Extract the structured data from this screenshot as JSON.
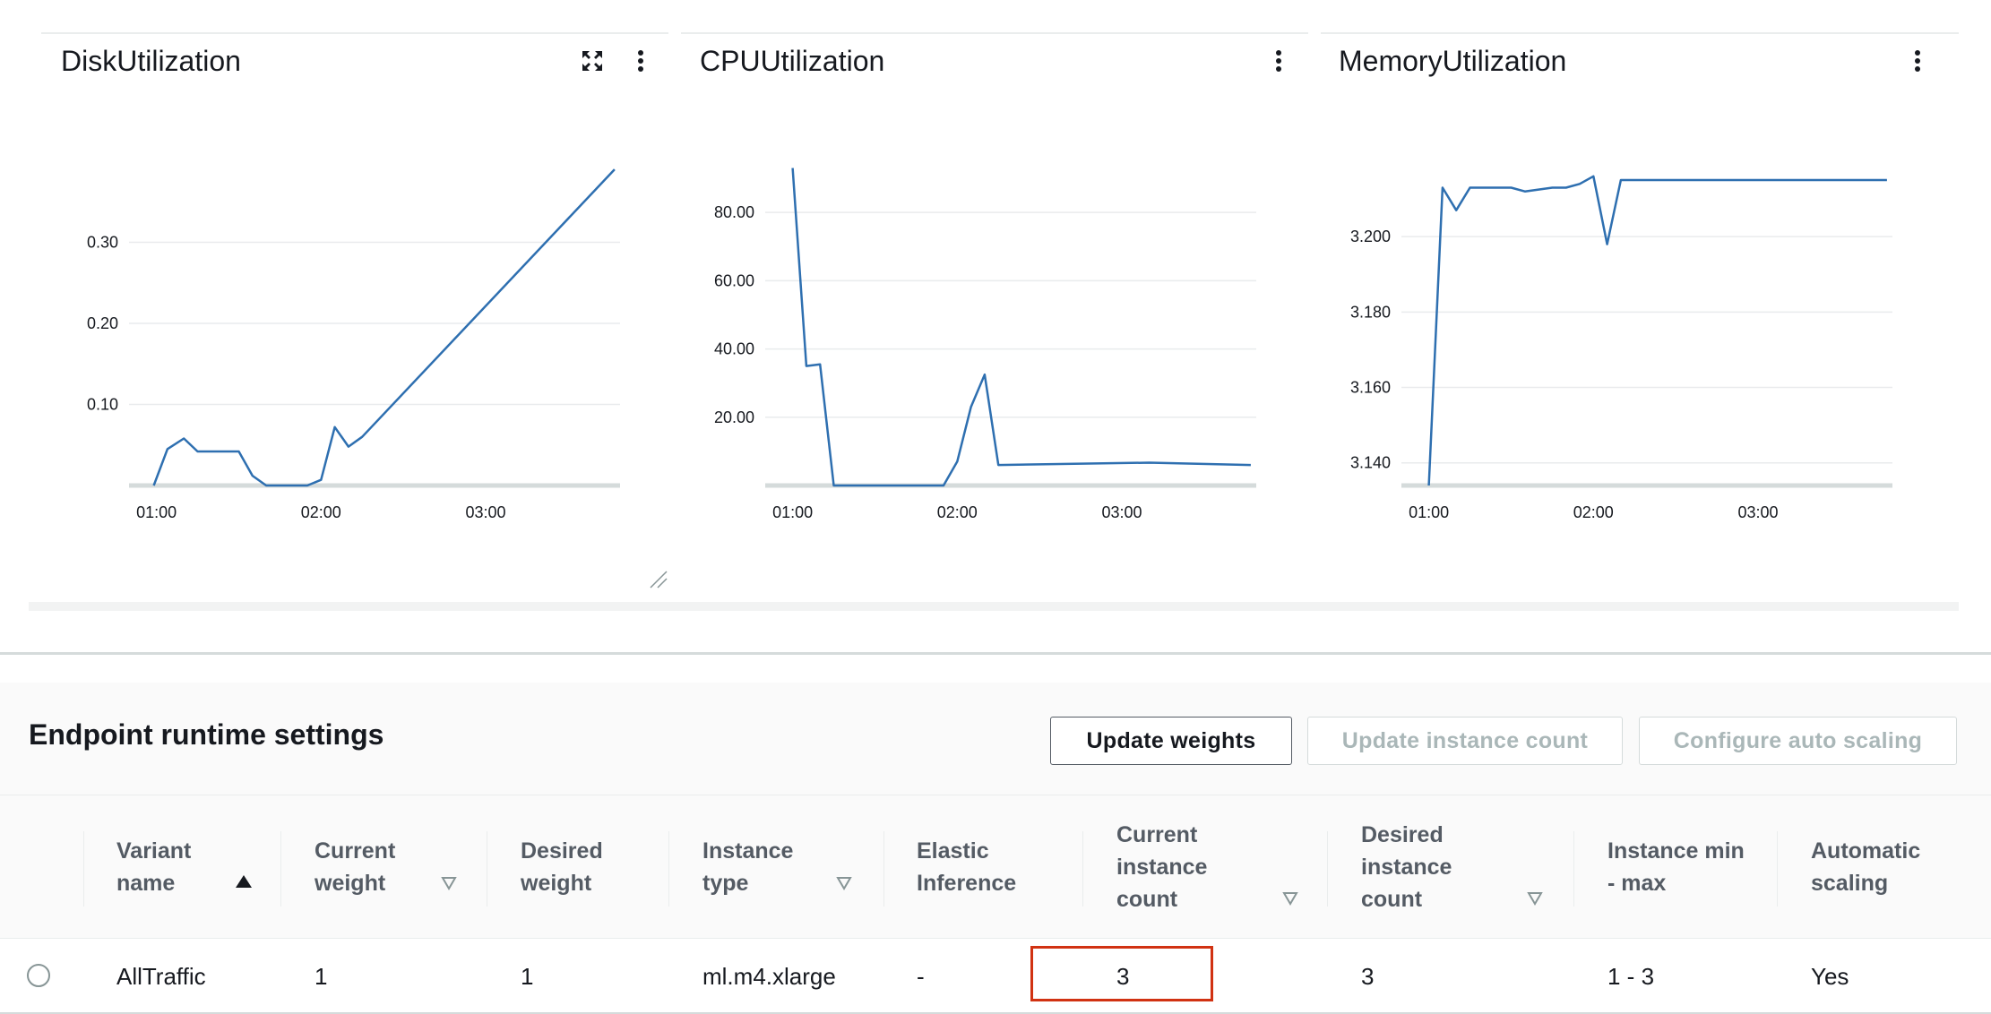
{
  "metrics": {
    "widgets": [
      {
        "title": "DiskUtilization",
        "has_expand": true
      },
      {
        "title": "CPUUtilization",
        "has_expand": false
      },
      {
        "title": "MemoryUtilization",
        "has_expand": false
      }
    ]
  },
  "chart_data": [
    {
      "type": "line",
      "title": "DiskUtilization",
      "x": [
        "00:59",
        "01:04",
        "01:10",
        "01:15",
        "01:20",
        "01:25",
        "01:30",
        "01:35",
        "01:40",
        "01:45",
        "01:50",
        "01:55",
        "02:00",
        "02:05",
        "02:10",
        "02:15",
        "03:47"
      ],
      "y": [
        0.0,
        0.045,
        0.058,
        0.042,
        0.042,
        0.042,
        0.042,
        0.012,
        0.0,
        0.0,
        0.0,
        0.0,
        0.007,
        0.072,
        0.048,
        0.06,
        0.39
      ],
      "x_ticks": [
        "01:00",
        "02:00",
        "03:00"
      ],
      "y_ticks": [
        "0.30",
        "0.20",
        "0.10"
      ],
      "ylim": [
        0,
        0.4
      ],
      "color": "#2e6fb0"
    },
    {
      "type": "line",
      "title": "CPUUtilization",
      "x": [
        "01:00",
        "01:05",
        "01:10",
        "01:15",
        "01:20",
        "01:55",
        "02:00",
        "02:05",
        "02:10",
        "02:15",
        "03:10",
        "03:47"
      ],
      "y": [
        93.0,
        35.0,
        35.5,
        0.0,
        0.0,
        0.0,
        7.0,
        23.0,
        32.5,
        6.0,
        6.7,
        6.0
      ],
      "x_ticks": [
        "01:00",
        "02:00",
        "03:00"
      ],
      "y_ticks": [
        "80.00",
        "60.00",
        "40.00",
        "20.00"
      ],
      "ylim": [
        0,
        95
      ],
      "color": "#2e6fb0"
    },
    {
      "type": "line",
      "title": "MemoryUtilization",
      "x": [
        "01:00",
        "01:05",
        "01:10",
        "01:15",
        "01:20",
        "01:25",
        "01:30",
        "01:35",
        "01:40",
        "01:45",
        "01:50",
        "01:55",
        "02:00",
        "02:05",
        "02:10",
        "03:47"
      ],
      "y": [
        3.134,
        3.213,
        3.207,
        3.213,
        3.213,
        3.213,
        3.213,
        3.212,
        3.2125,
        3.213,
        3.213,
        3.214,
        3.216,
        3.198,
        3.215,
        3.215
      ],
      "x_ticks": [
        "01:00",
        "02:00",
        "03:00"
      ],
      "y_ticks": [
        "3.200",
        "3.180",
        "3.160",
        "3.140"
      ],
      "ylim": [
        3.134,
        3.22
      ],
      "color": "#2e6fb0"
    }
  ],
  "runtime": {
    "title": "Endpoint runtime settings",
    "buttons": {
      "update_weights": "Update weights",
      "update_instance_count": "Update instance count",
      "configure_auto_scaling": "Configure auto scaling"
    },
    "columns": [
      {
        "l1": "Variant",
        "l2": "name",
        "l3": ""
      },
      {
        "l1": "Current",
        "l2": "weight",
        "l3": ""
      },
      {
        "l1": "Desired",
        "l2": "weight",
        "l3": ""
      },
      {
        "l1": "Instance",
        "l2": "type",
        "l3": ""
      },
      {
        "l1": "Elastic",
        "l2": "Inference",
        "l3": ""
      },
      {
        "l1": "Current",
        "l2": "instance",
        "l3": "count"
      },
      {
        "l1": "Desired",
        "l2": "instance",
        "l3": "count"
      },
      {
        "l1": "Instance min",
        "l2": "- max",
        "l3": ""
      },
      {
        "l1": "Automatic",
        "l2": "scaling",
        "l3": ""
      }
    ],
    "row": {
      "variant_name": "AllTraffic",
      "current_weight": "1",
      "desired_weight": "1",
      "instance_type": "ml.m4.xlarge",
      "elastic_inference": "-",
      "current_instance_count": "3",
      "desired_instance_count": "3",
      "instance_min_max": "1 - 3",
      "automatic_scaling": "Yes"
    },
    "highlight_color": "#d13212"
  }
}
